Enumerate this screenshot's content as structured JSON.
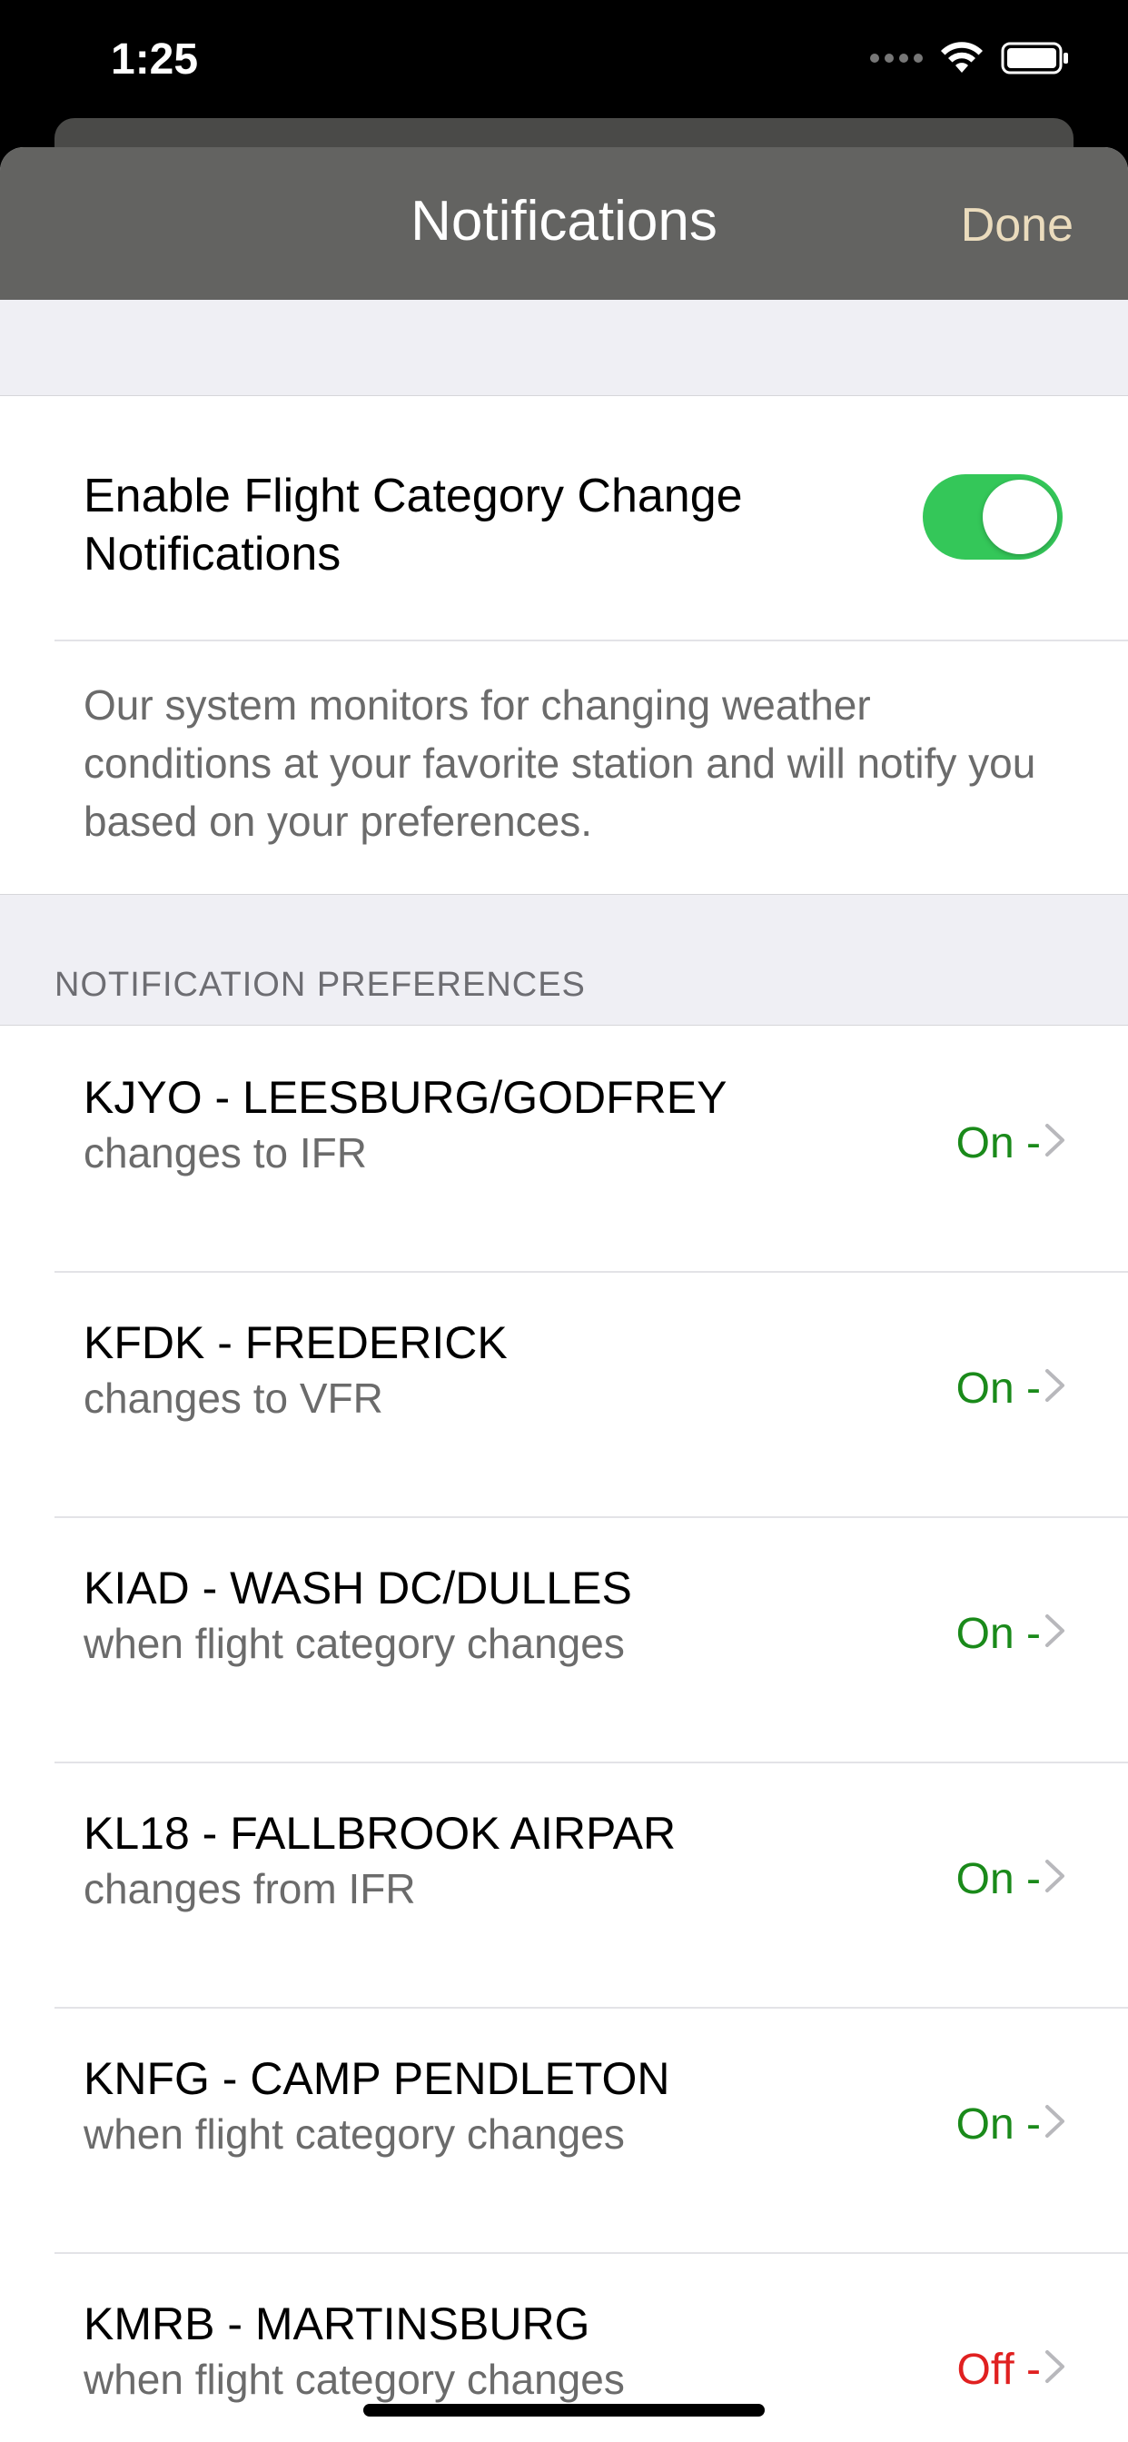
{
  "status_bar": {
    "time": "1:25"
  },
  "navbar": {
    "title": "Notifications",
    "done_label": "Done"
  },
  "toggle": {
    "label": "Enable Flight Category Change Notifications",
    "enabled": true
  },
  "description": "Our system monitors for changing weather conditions at your favorite station and will notify you based on your preferences.",
  "section_header": "NOTIFICATION PREFERENCES",
  "colors": {
    "on": "#1a8a1a",
    "off": "#e02020",
    "switch_on": "#34c759",
    "navbar": "#636361",
    "done": "#ebdcbd"
  },
  "preferences": [
    {
      "station": "KJYO - LEESBURG/GODFREY",
      "detail": "changes to IFR",
      "status": "On -",
      "state": "on"
    },
    {
      "station": "KFDK - FREDERICK",
      "detail": "changes to VFR",
      "status": "On -",
      "state": "on"
    },
    {
      "station": "KIAD - WASH DC/DULLES",
      "detail": "when flight category changes",
      "status": "On -",
      "state": "on"
    },
    {
      "station": "KL18 - FALLBROOK AIRPAR",
      "detail": "changes from IFR",
      "status": "On -",
      "state": "on"
    },
    {
      "station": "KNFG - CAMP PENDLETON",
      "detail": "when flight category changes",
      "status": "On -",
      "state": "on"
    },
    {
      "station": "KMRB - MARTINSBURG",
      "detail": "when flight category changes",
      "status": "Off -",
      "state": "off"
    }
  ]
}
